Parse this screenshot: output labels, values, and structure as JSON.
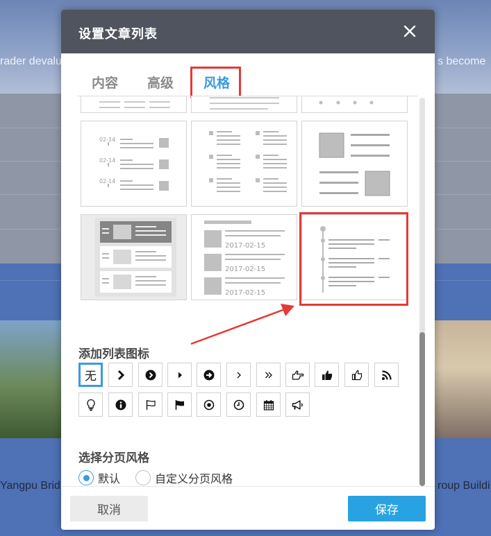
{
  "background": {
    "top_left_text": "rader devalu",
    "top_right_text": "s become",
    "caption_left": "Yangpu Brid",
    "caption_right": "roup Buildi"
  },
  "dialog": {
    "title": "设置文章列表",
    "tabs": [
      {
        "label": "内容",
        "active": false
      },
      {
        "label": "高级",
        "active": false
      },
      {
        "label": "风格",
        "active": true
      }
    ],
    "style_thumbnails": {
      "dates_a": [
        "02-14",
        "02-14",
        "02-14"
      ],
      "dates_b": [
        "2017-02-15",
        "2017-02-15",
        "2017-02-15"
      ]
    },
    "list_icon_section_title": "添加列表图标",
    "list_icons": [
      {
        "name": "none",
        "label": "无",
        "selected": true
      },
      {
        "name": "chevron-bold-icon"
      },
      {
        "name": "circle-chevron-icon"
      },
      {
        "name": "caret-right-icon"
      },
      {
        "name": "circle-arrow-right-icon"
      },
      {
        "name": "angle-right-icon"
      },
      {
        "name": "double-angle-right-icon"
      },
      {
        "name": "hand-point-right-outline-icon"
      },
      {
        "name": "thumbs-up-solid-icon"
      },
      {
        "name": "thumbs-up-outline-icon"
      },
      {
        "name": "rss-icon"
      },
      {
        "name": "lightbulb-icon"
      },
      {
        "name": "info-circle-icon"
      },
      {
        "name": "flag-outline-icon"
      },
      {
        "name": "flag-solid-icon"
      },
      {
        "name": "dot-circle-icon"
      },
      {
        "name": "clock-icon"
      },
      {
        "name": "calendar-icon"
      },
      {
        "name": "bullhorn-icon"
      }
    ],
    "pagination_section_title": "选择分页风格",
    "pagination_options": [
      {
        "label": "默认",
        "selected": true
      },
      {
        "label": "自定义分页风格",
        "selected": false
      }
    ],
    "cancel_label": "取消",
    "save_label": "保存"
  },
  "colors": {
    "accent": "#3a9ae0",
    "save_button": "#29a2e2",
    "highlight": "#e53935",
    "header": "#4f545e"
  }
}
